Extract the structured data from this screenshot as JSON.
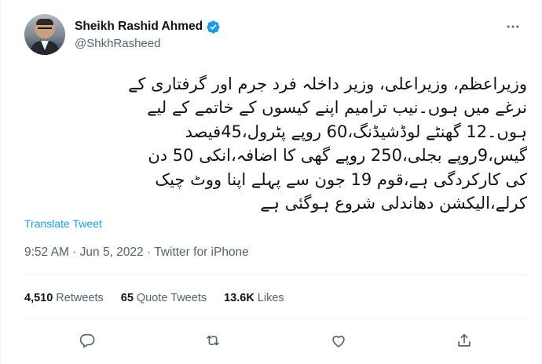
{
  "tweet": {
    "author": {
      "display_name": "Sheikh Rashid Ahmed",
      "handle": "@ShkhRasheed",
      "verified_icon": "verified-badge-icon"
    },
    "body_lines": [
      "وزیراعظم، وزیراعلی، وزیر داخلہ فرد جرم اور گرفتاری کے",
      "نرغے میں ہوں۔نیب ترامیم اپنے کیسوں کے خاتمے کے لیے",
      "ہوں۔12 گھنٹے لوڈشیڈنگ،60 روپے پٹرول،45فیصد",
      "گیس،9روپے بجلی،250 روپے گھی کا اضافہ،انکی 50 دن",
      "کی کارکردگی ہے،قوم 19 جون سے پہلے اپنا ووٹ چیک",
      "کرلے،الیکشن دھاندلی شروع ہوگئی ہے"
    ],
    "translate_label": "Translate Tweet",
    "time": "9:52 AM",
    "date": "Jun 5, 2022",
    "separator": "·",
    "source": "Twitter for iPhone",
    "stats": {
      "retweets_count": "4,510",
      "retweets_label": "Retweets",
      "quotes_count": "65",
      "quotes_label": "Quote Tweets",
      "likes_count": "13.6K",
      "likes_label": "Likes"
    },
    "actions": [
      "reply-icon",
      "retweet-icon",
      "like-icon",
      "share-icon"
    ],
    "colors": {
      "accent": "#1d9bf0",
      "text": "#0f1419",
      "secondary": "#536471",
      "divider": "#eff3f4"
    }
  }
}
